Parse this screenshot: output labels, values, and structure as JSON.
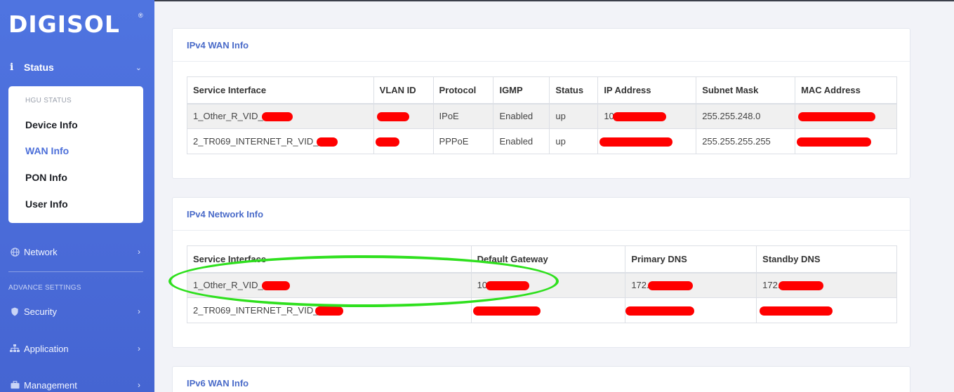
{
  "sidebar": {
    "logo": "DIGISOL",
    "logo_mark": "®",
    "status_label": "Status",
    "submenu_heading": "HGU STATUS",
    "submenu": [
      "Device Info",
      "WAN Info",
      "PON Info",
      "User Info"
    ],
    "active_item": "WAN Info",
    "network_label": "Network",
    "advance_heading": "ADVANCE SETTINGS",
    "security_label": "Security",
    "application_label": "Application",
    "management_label": "Management"
  },
  "wan": {
    "title": "IPv4 WAN Info",
    "headers": [
      "Service Interface",
      "VLAN ID",
      "Protocol",
      "IGMP",
      "Status",
      "IP Address",
      "Subnet Mask",
      "MAC Address"
    ],
    "rows": [
      {
        "service": "1_Other_R_VID_",
        "protocol": "IPoE",
        "igmp": "Enabled",
        "status": "up",
        "ip_prefix": "10",
        "subnet": "255.255.248.0"
      },
      {
        "service": "2_TR069_INTERNET_R_VID_",
        "protocol": "PPPoE",
        "igmp": "Enabled",
        "status": "up",
        "ip_prefix": "",
        "subnet": "255.255.255.255"
      }
    ]
  },
  "network": {
    "title": "IPv4 Network Info",
    "headers": [
      "Service Interface",
      "Default Gateway",
      "Primary DNS",
      "Standby DNS"
    ],
    "rows": [
      {
        "service": "1_Other_R_VID_",
        "gateway_prefix": "10",
        "primary_prefix": "172.",
        "standby_prefix": "172."
      },
      {
        "service": "2_TR069_INTERNET_R_VID_",
        "gateway_prefix": "",
        "primary_prefix": "",
        "standby_prefix": ""
      }
    ]
  },
  "ipv6": {
    "title": "IPv6 WAN Info"
  },
  "colors": {
    "sidebar": "#4a6bd8",
    "accent": "#4c6fd9",
    "redaction": "#ff0000",
    "highlight": "#2fe01e"
  }
}
